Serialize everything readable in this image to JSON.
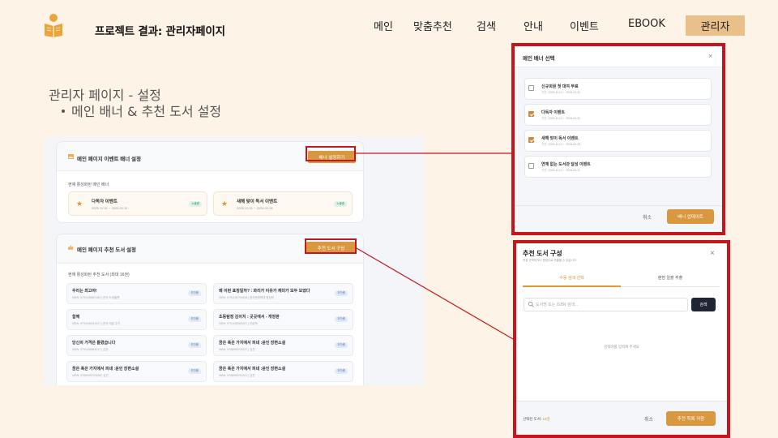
{
  "slide": {
    "title": "프로젝트 결과: 관리자페이지",
    "section_title": "관리자 페이지 - 설정",
    "section_bullet": "메인 배너 & 추천 도서 설정"
  },
  "nav": {
    "items": [
      "메인",
      "맞춤추천",
      "검색",
      "안내",
      "이벤트",
      "EBOOK"
    ],
    "active": "관리자"
  },
  "banner_card": {
    "title": "메인 페이지 이벤트 배너 설정",
    "button": "배너 설정하기",
    "sub_label": "현재 활성화된 메인 배너",
    "items": [
      {
        "name": "다독자 이벤트",
        "date": "2025.12.01 ~ 2026.01.31",
        "status": "노출중"
      },
      {
        "name": "새해 맞이 독서 이벤트",
        "date": "2025.12.01 ~ 2026.02.28",
        "status": "노출중"
      }
    ]
  },
  "book_card": {
    "title": "메인 페이지 추천 도서 설정",
    "button": "추천 도서 구성",
    "sub_label": "현재 활성화된 추천 도서 (최대 16권)",
    "badge": "추천중",
    "books": [
      {
        "title": "우리는 최고야!",
        "info": "ISBN: 9791165883180 | 한국 도재필름"
      },
      {
        "title": "왜 이런 표정일까? : 화리가 이유가 재미가 모두 모였다",
        "info": "ISBN: 9791155791848 | 한국문예학대 명집부"
      },
      {
        "title": "함께",
        "info": "ISBN: 9791165321427 | 한국 재발 주거"
      },
      {
        "title": "초등탐정 김이지 : 곳곳에서 - 개정판",
        "info": "ISBN: 9791155364007 | 미로책"
      },
      {
        "title": "당신의 가격은 틀렸습니다",
        "info": "ISBN: 9791165883017 | 김찬"
      },
      {
        "title": "꿈은 혹은 가지에서 피네 :윤인 장편소설",
        "info": "ISBN: 9788999704157 | 김찬"
      },
      {
        "title": "꿈은 혹은 가지에서 피네 :윤인 장편소설",
        "info": "ISBN: 9788999704188 | 김찬"
      },
      {
        "title": "꿈은 혹은 가지에서 피네 :윤인 장편소설",
        "info": "ISBN: 9788999704511 | 김찬"
      }
    ]
  },
  "banner_modal": {
    "title": "메인 배너 선택",
    "options": [
      {
        "name": "신규회원 첫 대여 무료",
        "date": "기간: 2025-12-01 ~ 2026-12-31",
        "checked": false
      },
      {
        "name": "다독자 이벤트",
        "date": "기간: 2025-12-01 ~ 2026-01-31",
        "checked": true
      },
      {
        "name": "새해 맞이 독서 이벤트",
        "date": "기간: 2025-12-01 ~ 2026-02-28",
        "checked": true
      },
      {
        "name": "연체 없는 도서관 달성 이벤트",
        "date": "기간: 2025-12-01 ~ 2026-01-11",
        "checked": false
      }
    ],
    "cancel": "취소",
    "confirm": "배너 업데이트"
  },
  "book_modal": {
    "title": "추천 도서 구성",
    "subtitle": "직접 선택하거나 랜덤으로 추출할 수 있습니다.",
    "tabs": [
      "수동 검색 선택",
      "랜덤 일괄 추출"
    ],
    "search_placeholder": "도서명 또는 ISBN 검색...",
    "search_button": "검색",
    "empty_text": "검색어를 입력해 주세요",
    "selected_label": "선택된 도서: ",
    "selected_count": "16권",
    "cancel": "취소",
    "confirm": "추천 목록 저장"
  },
  "colors": {
    "background": "#fdf3e6",
    "accent": "#d9973f",
    "highlight": "#c4161c",
    "admin_nav": "#e9bf8a"
  }
}
